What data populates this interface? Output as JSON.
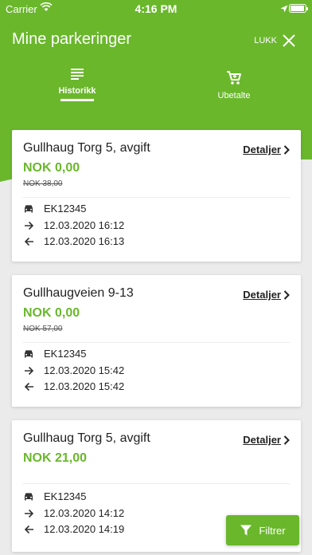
{
  "status_bar": {
    "carrier": "Carrier",
    "time": "4:16 PM"
  },
  "header": {
    "title": "Mine parkeringer",
    "close_label": "LUKK",
    "tabs": [
      {
        "label": "Historikk",
        "icon": "list-icon",
        "active": true
      },
      {
        "label": "Ubetalte",
        "icon": "cart-icon",
        "active": false
      }
    ]
  },
  "cards": [
    {
      "title": "Gullhaug Torg 5, avgift",
      "details_label": "Detaljer",
      "price": "NOK 0,00",
      "old_price": "NOK 38,00",
      "plate": "EK12345",
      "start": "12.03.2020 16:12",
      "end": "12.03.2020 16:13"
    },
    {
      "title": "Gullhaugveien 9-13",
      "details_label": "Detaljer",
      "price": "NOK 0,00",
      "old_price": "NOK 57,00",
      "plate": "EK12345",
      "start": "12.03.2020 15:42",
      "end": "12.03.2020 15:42"
    },
    {
      "title": "Gullhaug Torg 5, avgift",
      "details_label": "Detaljer",
      "price": "NOK 21,00",
      "old_price": "",
      "plate": "EK12345",
      "start": "12.03.2020 14:12",
      "end": "12.03.2020 14:19"
    }
  ],
  "filter_button": {
    "label": "Filtrer"
  },
  "colors": {
    "brand_green": "#6ab72c"
  }
}
